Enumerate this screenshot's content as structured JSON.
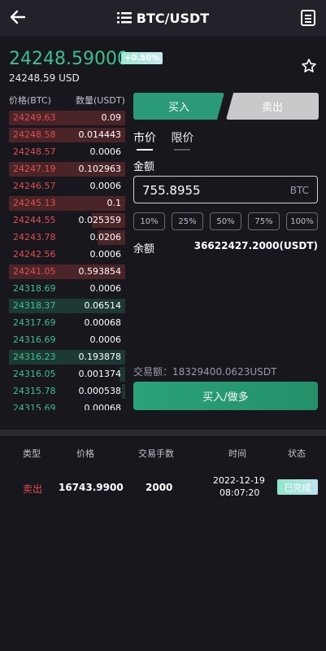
{
  "header": {
    "title": "BTC/USDT",
    "back_icon": "arrow-left-icon",
    "list_icon": "list-icon",
    "doc_icon": "document-icon"
  },
  "ticker": {
    "price": "24248.59000",
    "change": "+0.50%",
    "price_usd": "24248.59 USD",
    "favorite_icon": "star-icon"
  },
  "orderbook": {
    "col_price": "价格(BTC)",
    "col_qty": "数量(USDT)",
    "sells": [
      {
        "price": "24249.63",
        "qty": "0.09",
        "depth": 1.0
      },
      {
        "price": "24248.58",
        "qty": "0.014443",
        "depth": 1.0
      },
      {
        "price": "24248.57",
        "qty": "0.0006",
        "depth": 0.0
      },
      {
        "price": "24247.19",
        "qty": "0.102963",
        "depth": 1.0
      },
      {
        "price": "24246.57",
        "qty": "0.0006",
        "depth": 0.0
      },
      {
        "price": "24245.13",
        "qty": "0.1",
        "depth": 1.0
      },
      {
        "price": "24244.55",
        "qty": "0.025359",
        "depth": 0.29
      },
      {
        "price": "24243.78",
        "qty": "0.0206",
        "depth": 0.24
      },
      {
        "price": "24242.56",
        "qty": "0.0006",
        "depth": 0.0
      },
      {
        "price": "24241.05",
        "qty": "0.593854",
        "depth": 1.0
      }
    ],
    "buys": [
      {
        "price": "24318.69",
        "qty": "0.0006",
        "depth": 0.0
      },
      {
        "price": "24318.37",
        "qty": "0.06514",
        "depth": 1.0
      },
      {
        "price": "24317.69",
        "qty": "0.00068",
        "depth": 0.0
      },
      {
        "price": "24316.69",
        "qty": "0.0006",
        "depth": 0.0
      },
      {
        "price": "24316.23",
        "qty": "0.193878",
        "depth": 1.0
      },
      {
        "price": "24316.05",
        "qty": "0.001374",
        "depth": 0.05
      },
      {
        "price": "24315.78",
        "qty": "0.000538",
        "depth": 0.03
      },
      {
        "price": "24315.69",
        "qty": "0.00068",
        "depth": 0.0
      }
    ]
  },
  "trade": {
    "buy_tab": "买入",
    "sell_tab": "卖出",
    "market_tab": "市价",
    "limit_tab": "限价",
    "amount_label": "金额",
    "amount_value": "755.8955",
    "amount_unit": "BTC",
    "percents": [
      "10%",
      "25%",
      "50%",
      "75%",
      "100%"
    ],
    "balance_label": "余额",
    "balance_value": "36622427.2000(USDT)",
    "trade_amount": "交易额：18329400.0623USDT",
    "submit_label": "买入/做多"
  },
  "history": {
    "headers": [
      "类型",
      "价格",
      "交易手数",
      "时间",
      "状态"
    ],
    "rows": [
      {
        "type": "卖出",
        "price": "16743.9900",
        "lots": "2000",
        "date": "2022-12-19",
        "time": "08:07:20",
        "status": "已完成"
      }
    ]
  },
  "colors": {
    "bg": "#17171d",
    "green": "#3fbf8f",
    "red": "#e05050",
    "buy_button": "#2a9a78"
  }
}
